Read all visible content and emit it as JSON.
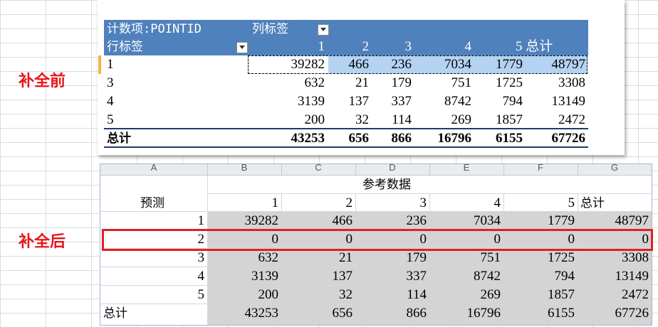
{
  "labels": {
    "before": "补全前",
    "after": "补全后"
  },
  "pivot": {
    "header_count": "计数项:POINTID",
    "header_col_label": "列标签",
    "header_row_label": "行标签",
    "columns": [
      "1",
      "2",
      "3",
      "4",
      "5 总计"
    ],
    "rows": [
      {
        "key": "1",
        "values": [
          "39282",
          "466",
          "236",
          "7034",
          "1779",
          "48797"
        ]
      },
      {
        "key": "3",
        "values": [
          "632",
          "21",
          "179",
          "751",
          "1725",
          "3308"
        ]
      },
      {
        "key": "4",
        "values": [
          "3139",
          "137",
          "337",
          "8742",
          "794",
          "13149"
        ]
      },
      {
        "key": "5",
        "values": [
          "200",
          "32",
          "114",
          "269",
          "1857",
          "2472"
        ]
      }
    ],
    "total": {
      "key": "总计",
      "values": [
        "43253",
        "656",
        "866",
        "16796",
        "6155",
        "67726"
      ]
    }
  },
  "sheet": {
    "col_headers": [
      "A",
      "B",
      "C",
      "D",
      "E",
      "F",
      "G"
    ],
    "title": "参考数据",
    "row_header_label": "预测",
    "columns": [
      "1",
      "2",
      "3",
      "4",
      "5",
      "总计"
    ],
    "rows": [
      {
        "key": "1",
        "values": [
          "39282",
          "466",
          "236",
          "7034",
          "1779",
          "48797"
        ]
      },
      {
        "key": "2",
        "values": [
          "0",
          "0",
          "0",
          "0",
          "0",
          "0"
        ]
      },
      {
        "key": "3",
        "values": [
          "632",
          "21",
          "179",
          "751",
          "1725",
          "3308"
        ]
      },
      {
        "key": "4",
        "values": [
          "3139",
          "137",
          "337",
          "8742",
          "794",
          "13149"
        ]
      },
      {
        "key": "5",
        "values": [
          "200",
          "32",
          "114",
          "269",
          "1857",
          "2472"
        ]
      }
    ],
    "total": {
      "key": "总计",
      "values": [
        "43253",
        "656",
        "866",
        "16796",
        "6155",
        "67726"
      ]
    }
  }
}
